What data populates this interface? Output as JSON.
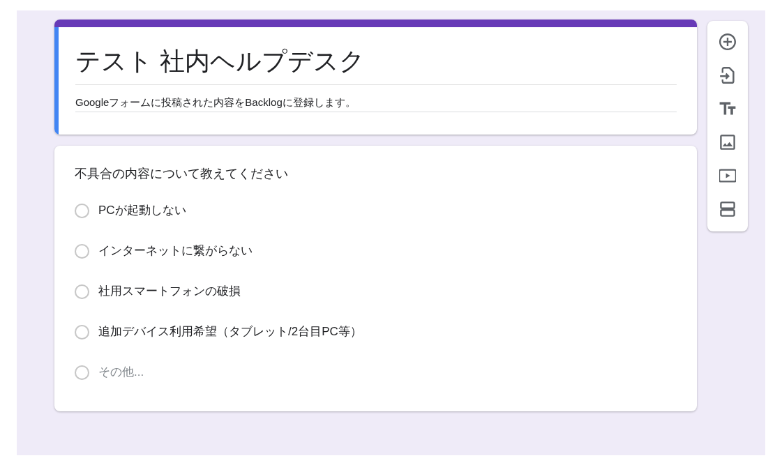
{
  "form": {
    "title": "テスト 社内ヘルプデスク",
    "description": "Googleフォームに投稿された内容をBacklogに登録します。"
  },
  "question": {
    "title": "不具合の内容について教えてください",
    "options": [
      {
        "label": "PCが起動しない",
        "kind": "choice",
        "selected": false
      },
      {
        "label": "インターネットに繋がらない",
        "kind": "choice",
        "selected": false
      },
      {
        "label": "社用スマートフォンの破損",
        "kind": "choice",
        "selected": false
      },
      {
        "label": "追加デバイス利用希望（タブレット/2台目PC等）",
        "kind": "choice",
        "selected": false
      },
      {
        "label": "その他...",
        "kind": "other",
        "selected": false
      }
    ]
  }
}
